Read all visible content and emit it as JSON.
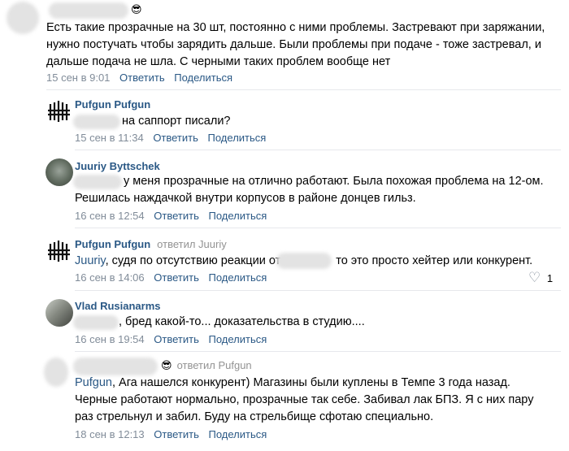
{
  "comments": [
    {
      "text": [
        "Есть такие прозрачные на 30 шт, постоянно с ними проблемы. Застревают при заряжании,",
        "нужно постучать чтобы зарядить дальше. Были проблемы при подаче - тоже застревал, и",
        "дальше подача не шла. С черными таких проблем вообще нет"
      ],
      "date": "15 сен в 9:01",
      "reply": "Ответить",
      "share": "Поделиться"
    },
    {
      "author": "Pufgun Pufgun",
      "text": "на саппорт писали?",
      "date": "15 сен в 11:34",
      "reply": "Ответить",
      "share": "Поделиться"
    },
    {
      "author": "Juuriy Byttschek",
      "text": [
        "у меня прозрачные на отлично работают. Была похожая проблема на 12-ом.",
        "Решилась наждачкой внутри корпусов в районе донцев гильз."
      ],
      "date": "16 сен в 12:54",
      "reply": "Ответить",
      "share": "Поделиться"
    },
    {
      "author": "Pufgun Pufgun",
      "replied_to": "ответил Juuriy",
      "mention": "Juuriy",
      "text_a": ", судя по отсутствию реакции от",
      "text_b": "то это просто хейтер или конкурент.",
      "date": "16 сен в 14:06",
      "reply": "Ответить",
      "share": "Поделиться",
      "likes": "1"
    },
    {
      "author": "Vlad Rusianarms",
      "text": ", бред какой-то... доказательства в студию....",
      "date": "16 сен в 19:54",
      "reply": "Ответить",
      "share": "Поделиться"
    },
    {
      "replied_to": "ответил Pufgun",
      "mention": "Pufgun",
      "text_first": ", Ага нашелся конкурент) Магазины были куплены в Темпе 3 года назад.",
      "text": [
        "Черные работают нормально, прозрачные так себе. Забивал лак БПЗ. Я с них пару",
        "раз стрельнул и забил. Буду на стрельбище сфотаю специально."
      ],
      "date": "18 сен в 12:13",
      "reply": "Ответить",
      "share": "Поделиться"
    }
  ],
  "icons": {
    "emoji": "😎",
    "heart": "♡"
  },
  "colors": {
    "link": "#2a5885",
    "meta": "#818c99",
    "blur": "#e3e3e3"
  }
}
